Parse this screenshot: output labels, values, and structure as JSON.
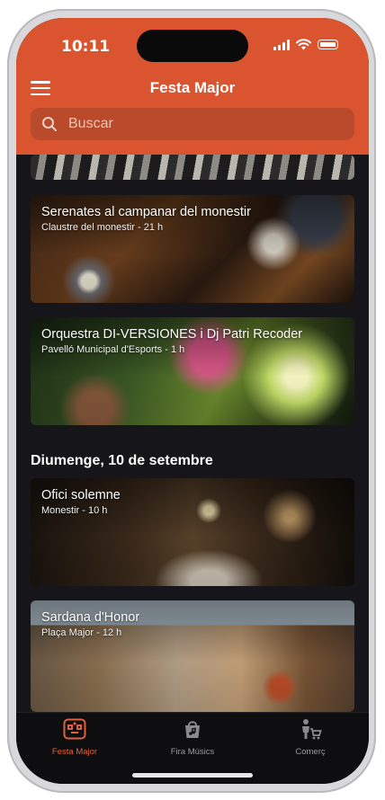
{
  "status_bar": {
    "time": "10:11"
  },
  "header": {
    "title": "Festa Major"
  },
  "search": {
    "placeholder": "Buscar"
  },
  "events": [
    {
      "title": "Serenates al campanar del monestir",
      "subtitle": "Claustre del monestir - 21 h"
    },
    {
      "title": "Orquestra DI-VERSIONES i Dj Patri Recoder",
      "subtitle": "Pavelló Municipal d'Esports - 1 h"
    }
  ],
  "day_heading": "Diumenge, 10 de setembre",
  "sunday_events": [
    {
      "title": "Ofici solemne",
      "subtitle": "Monestir - 10 h"
    },
    {
      "title": "Sardana d'Honor",
      "subtitle": "Plaça Major - 12 h"
    }
  ],
  "tabs": [
    {
      "label": "Festa Major",
      "icon": "festa-icon",
      "active": true
    },
    {
      "label": "Fira Músics",
      "icon": "shopping-bag-music-icon",
      "active": false
    },
    {
      "label": "Comerç",
      "icon": "shopper-cart-icon",
      "active": false
    }
  ],
  "colors": {
    "accent": "#d9542f",
    "background": "#16161a",
    "tab_active": "#e0603a"
  }
}
